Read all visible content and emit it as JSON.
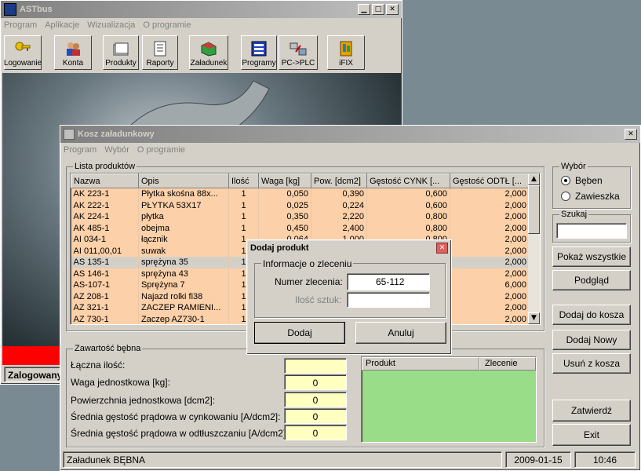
{
  "main_window": {
    "title": "ASTbus",
    "menu": [
      "Program",
      "Aplikacje",
      "Wizualizacja",
      "O programie"
    ],
    "toolbar": [
      {
        "label": "Logowanie",
        "icon": "keys-icon"
      },
      {
        "label": "Konta",
        "icon": "users-icon"
      },
      {
        "label": "Produkty",
        "icon": "folder-icon"
      },
      {
        "label": "Raporty",
        "icon": "report-icon"
      },
      {
        "label": "Załadunek",
        "icon": "box-icon"
      },
      {
        "label": "Programy",
        "icon": "grid-icon"
      },
      {
        "label": "PC->PLC",
        "icon": "transfer-icon"
      },
      {
        "label": "iFIX",
        "icon": "ifix-icon"
      }
    ],
    "status_left": "Zalogowany"
  },
  "dialog": {
    "title": "Kosz załadunkowy",
    "menu": [
      "Program",
      "Wybór",
      "O programie"
    ],
    "product_list": {
      "label": "Lista produktów",
      "columns": [
        "Nazwa",
        "Opis",
        "Ilość",
        "Waga [kg]",
        "Pow. [dcm2]",
        "Gęstość CYNK [...",
        "Gęstość ODTŁ [..."
      ],
      "rows": [
        [
          "AK  223-1",
          "Płytka skośna  88x...",
          "1",
          "0,050",
          "0,390",
          "0,600",
          "2,000"
        ],
        [
          "AK  222-1",
          "PŁYTKA  53X17",
          "1",
          "0,025",
          "0,224",
          "0,600",
          "2,000"
        ],
        [
          "AK  224-1",
          "płytka",
          "1",
          "0,350",
          "2,220",
          "0,800",
          "2,000"
        ],
        [
          "AK  485-1",
          "obejma",
          "1",
          "0,450",
          "2,400",
          "0,800",
          "2,000"
        ],
        [
          "AI  034-1",
          "łącznik",
          "1",
          "0,064",
          "1,000",
          "0,800",
          "2,000"
        ],
        [
          "AI 011,00,01",
          "suwak",
          "1",
          "",
          "",
          "",
          "2,000"
        ],
        [
          "AS 135-1",
          "sprężyna 35",
          "1",
          "",
          "",
          "",
          "2,000"
        ],
        [
          "AS 146-1",
          "sprężyna 43",
          "1",
          "",
          "",
          "",
          "2,000"
        ],
        [
          "AS-107-1",
          "Sprężyna 7",
          "1",
          "",
          "",
          "",
          "6,000"
        ],
        [
          "AZ 208-1",
          "Najazd rolki fi38",
          "1",
          "",
          "",
          "",
          "2,000"
        ],
        [
          "AZ 321-1",
          "ZACZEP RAMIENI...",
          "1",
          "",
          "",
          "",
          "2,000"
        ],
        [
          "AZ 730-1",
          "Zaczep AZ730-1",
          "1",
          "",
          "",
          "",
          "2,000"
        ]
      ]
    },
    "wybor": {
      "label": "Wybór",
      "options": [
        "Bęben",
        "Zawieszka"
      ],
      "selected": "Bęben"
    },
    "szukaj": {
      "label": "Szukaj",
      "value": ""
    },
    "buttons": {
      "pokaz": "Pokaż wszystkie",
      "podglad": "Podgląd",
      "dodaj_do_kosza": "Dodaj do kosza",
      "dodaj_nowy": "Dodaj Nowy",
      "usun": "Usuń z kosza",
      "zatwierdz": "Zatwierdź",
      "exit": "Exit"
    },
    "zawartosc": {
      "label": "Zawartość bębna",
      "fields": [
        {
          "label": "Łączna ilość:",
          "value": ""
        },
        {
          "label": "Waga jednostkowa [kg]:",
          "value": "0"
        },
        {
          "label": "Powierzchnia jednostkowa [dcm2]:",
          "value": "0"
        },
        {
          "label": "Średnia gęstość prądowa w cynkowaniu [A/dcm2]:",
          "value": "0"
        },
        {
          "label": "Średnia gęstość prądowa w odtłuszczaniu [A/dcm2]:",
          "value": "0"
        }
      ]
    },
    "basket_table": {
      "columns": [
        "Produkt",
        "Zlecenie"
      ]
    },
    "status": {
      "left": "Załadunek BĘBNA",
      "date": "2009-01-15",
      "time": "10:46"
    }
  },
  "popup": {
    "title": "Dodaj produkt",
    "group_label": "Informacje o zleceniu",
    "numer_label": "Numer zlecenia:",
    "numer_value": "65-112",
    "ilosc_label": "Ilość sztuk:",
    "ilosc_value": "",
    "dodaj": "Dodaj",
    "anuluj": "Anuluj"
  },
  "colors": {
    "row_peach": "#fcd0a8",
    "basket_green": "#99dd88",
    "value_yellow": "#ffffc0"
  }
}
